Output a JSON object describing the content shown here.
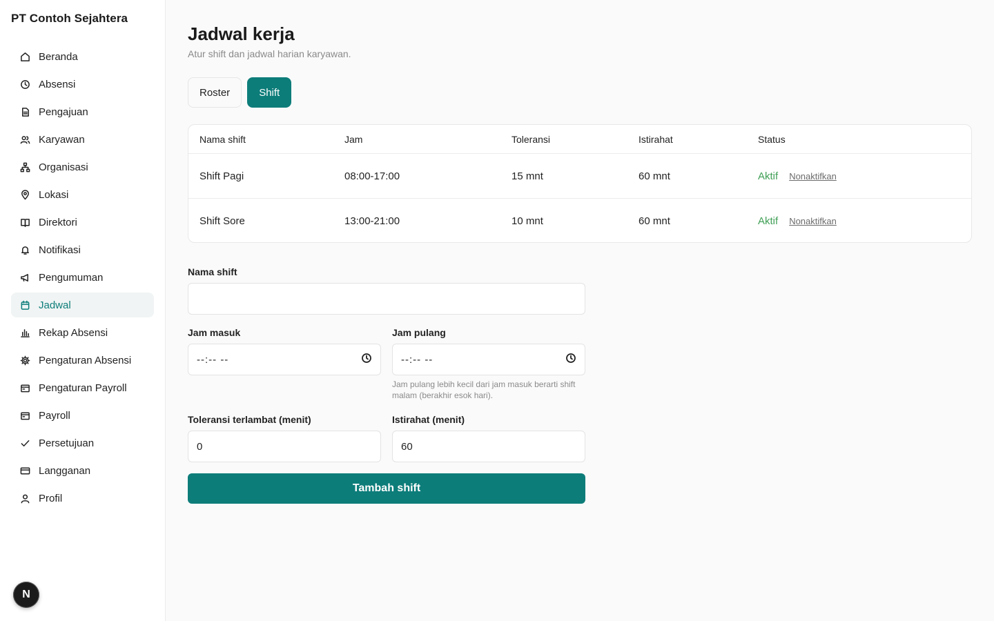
{
  "org_name": "PT Contoh Sejahtera",
  "sidebar": {
    "items": [
      {
        "label": "Beranda",
        "icon": "home-icon"
      },
      {
        "label": "Absensi",
        "icon": "clock-icon"
      },
      {
        "label": "Pengajuan",
        "icon": "document-icon"
      },
      {
        "label": "Karyawan",
        "icon": "users-icon"
      },
      {
        "label": "Organisasi",
        "icon": "org-chart-icon"
      },
      {
        "label": "Lokasi",
        "icon": "map-pin-icon"
      },
      {
        "label": "Direktori",
        "icon": "book-icon"
      },
      {
        "label": "Notifikasi",
        "icon": "bell-icon"
      },
      {
        "label": "Pengumuman",
        "icon": "megaphone-icon"
      },
      {
        "label": "Jadwal",
        "icon": "calendar-icon",
        "active": true
      },
      {
        "label": "Rekap Absensi",
        "icon": "bar-chart-icon"
      },
      {
        "label": "Pengaturan Absensi",
        "icon": "gear-icon"
      },
      {
        "label": "Pengaturan Payroll",
        "icon": "wallet-icon"
      },
      {
        "label": "Payroll",
        "icon": "wallet-icon"
      },
      {
        "label": "Persetujuan",
        "icon": "check-icon"
      },
      {
        "label": "Langganan",
        "icon": "credit-card-icon"
      },
      {
        "label": "Profil",
        "icon": "user-icon"
      }
    ]
  },
  "badge": "N",
  "page": {
    "title": "Jadwal kerja",
    "subtitle": "Atur shift dan jadwal harian karyawan."
  },
  "tabs": [
    {
      "label": "Roster",
      "active": false
    },
    {
      "label": "Shift",
      "active": true
    }
  ],
  "table": {
    "headers": [
      "Nama shift",
      "Jam",
      "Toleransi",
      "Istirahat",
      "Status"
    ],
    "rows": [
      {
        "name": "Shift Pagi",
        "jam": "08:00-17:00",
        "toleransi": "15 mnt",
        "istirahat": "60 mnt",
        "status": "Aktif",
        "action": "Nonaktifkan"
      },
      {
        "name": "Shift Sore",
        "jam": "13:00-21:00",
        "toleransi": "10 mnt",
        "istirahat": "60 mnt",
        "status": "Aktif",
        "action": "Nonaktifkan"
      }
    ]
  },
  "form": {
    "nama_label": "Nama shift",
    "nama_value": "",
    "masuk_label": "Jam masuk",
    "masuk_value": "--:-- --",
    "pulang_label": "Jam pulang",
    "pulang_value": "--:-- --",
    "pulang_hint": "Jam pulang lebih kecil dari jam masuk berarti shift malam (berakhir esok hari).",
    "toleransi_label": "Toleransi terlambat (menit)",
    "toleransi_value": "0",
    "istirahat_label": "Istirahat (menit)",
    "istirahat_value": "60",
    "submit_label": "Tambah shift"
  },
  "colors": {
    "accent": "#0d7d7a",
    "active_status": "#3f9f55"
  }
}
